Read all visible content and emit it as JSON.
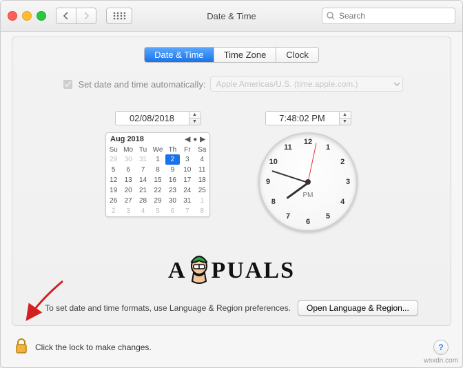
{
  "window": {
    "title": "Date & Time"
  },
  "search": {
    "placeholder": "Search"
  },
  "tabs": {
    "t0": "Date & Time",
    "t1": "Time Zone",
    "t2": "Clock"
  },
  "auto": {
    "label": "Set date and time automatically:",
    "server": "Apple Americas/U.S. (time.apple.com.)",
    "checked": true
  },
  "date_field": "02/08/2018",
  "time_field": "7:48:02 PM",
  "calendar": {
    "title": "Aug 2018",
    "dow": [
      "Su",
      "Mo",
      "Tu",
      "We",
      "Th",
      "Fr",
      "Sa"
    ],
    "rows": [
      [
        {
          "d": "29",
          "dim": true
        },
        {
          "d": "30",
          "dim": true
        },
        {
          "d": "31",
          "dim": true
        },
        {
          "d": "1"
        },
        {
          "d": "2",
          "sel": true
        },
        {
          "d": "3"
        },
        {
          "d": "4"
        }
      ],
      [
        {
          "d": "5"
        },
        {
          "d": "6"
        },
        {
          "d": "7"
        },
        {
          "d": "8"
        },
        {
          "d": "9"
        },
        {
          "d": "10"
        },
        {
          "d": "11"
        }
      ],
      [
        {
          "d": "12"
        },
        {
          "d": "13"
        },
        {
          "d": "14"
        },
        {
          "d": "15"
        },
        {
          "d": "16"
        },
        {
          "d": "17"
        },
        {
          "d": "18"
        }
      ],
      [
        {
          "d": "19"
        },
        {
          "d": "20"
        },
        {
          "d": "21"
        },
        {
          "d": "22"
        },
        {
          "d": "23"
        },
        {
          "d": "24"
        },
        {
          "d": "25"
        }
      ],
      [
        {
          "d": "26"
        },
        {
          "d": "27"
        },
        {
          "d": "28"
        },
        {
          "d": "29"
        },
        {
          "d": "30"
        },
        {
          "d": "31"
        },
        {
          "d": "1",
          "dim": true
        }
      ],
      [
        {
          "d": "2",
          "dim": true
        },
        {
          "d": "3",
          "dim": true
        },
        {
          "d": "4",
          "dim": true
        },
        {
          "d": "5",
          "dim": true
        },
        {
          "d": "6",
          "dim": true
        },
        {
          "d": "7",
          "dim": true
        },
        {
          "d": "8",
          "dim": true
        }
      ]
    ]
  },
  "clock": {
    "numbers": [
      "12",
      "1",
      "2",
      "3",
      "4",
      "5",
      "6",
      "7",
      "8",
      "9",
      "10",
      "11"
    ],
    "ampm": "PM",
    "hour_angle": 234,
    "minute_angle": 288,
    "second_angle": 12
  },
  "brand": {
    "left": "A",
    "right": "PUALS"
  },
  "footer": {
    "hint": "To set date and time formats, use Language & Region preferences.",
    "button": "Open Language & Region..."
  },
  "lock": {
    "text": "Click the lock to make changes."
  },
  "help": "?",
  "watermark": "wsxdn.com"
}
